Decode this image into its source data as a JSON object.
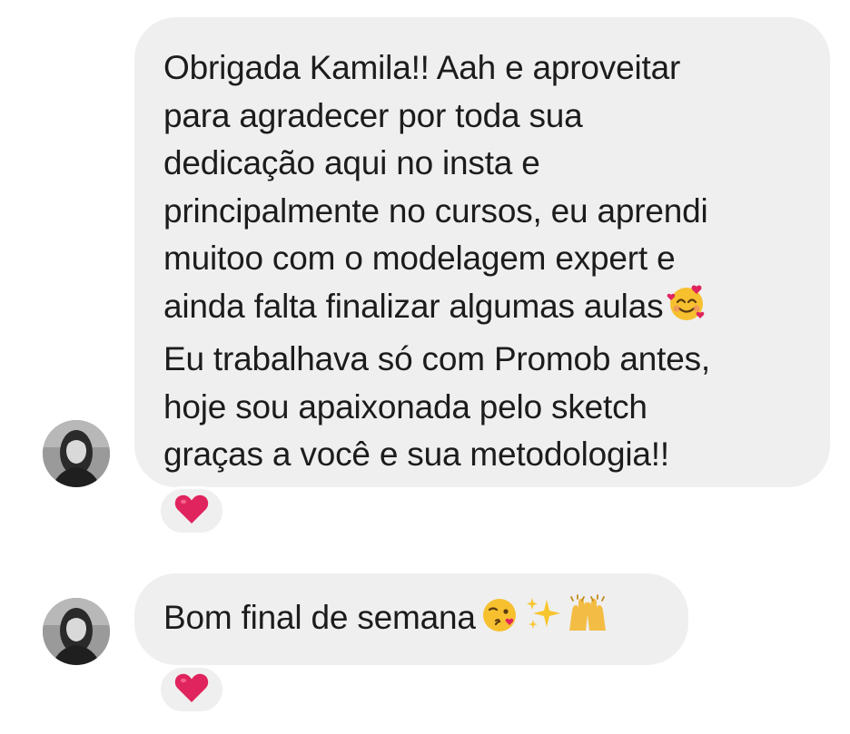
{
  "messages": [
    {
      "lines": [
        "Obrigada Kamila!! Aah e aproveitar",
        "para agradecer por toda sua",
        "dedicação aqui no insta e",
        "principalmente no cursos, eu aprendi",
        "muitoo com o modelagem expert e",
        "ainda falta finalizar algumas aulas",
        "Eu trabalhava só com Promob antes,",
        "hoje sou apaixonada pelo sketch",
        "graças a você e sua metodologia!!"
      ],
      "inline_emoji": "smiling-face-with-hearts",
      "reaction": "red-heart"
    },
    {
      "text": "Bom final de semana",
      "trailing_emojis": [
        "face-blowing-kiss",
        "sparkles",
        "raising-hands"
      ],
      "reaction": "red-heart"
    }
  ],
  "colors": {
    "bubble_bg": "#efefef",
    "text": "#1c1c1c",
    "heart": "#e0245e"
  }
}
